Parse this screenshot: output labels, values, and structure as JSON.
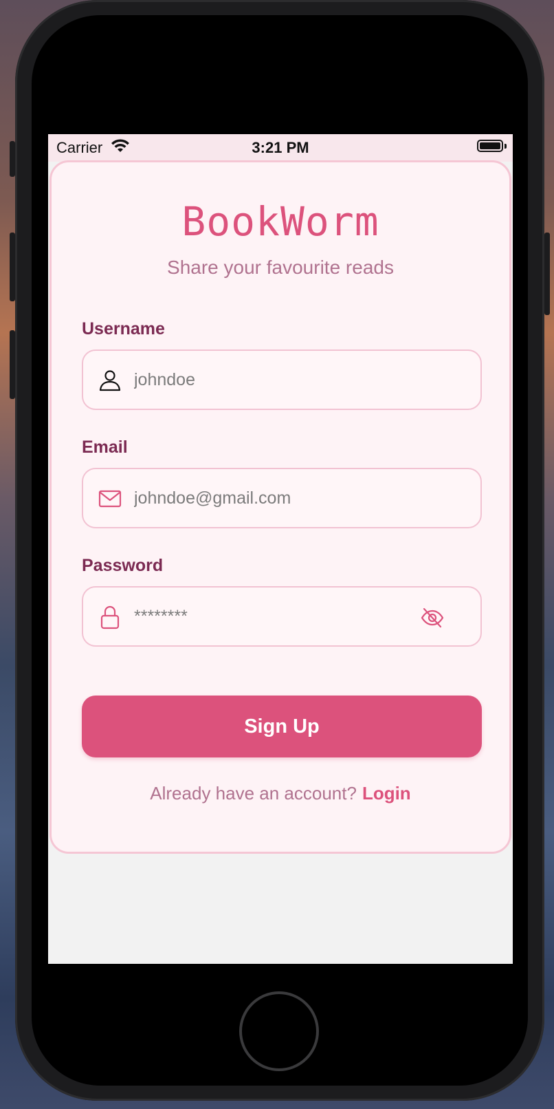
{
  "status_bar": {
    "carrier": "Carrier",
    "time": "3:21 PM",
    "wifi_icon": "wifi-icon",
    "battery_icon": "battery-full-icon"
  },
  "header": {
    "title": "BookWorm",
    "subtitle": "Share your favourite reads"
  },
  "form": {
    "username": {
      "label": "Username",
      "placeholder": "johndoe",
      "icon": "user-icon"
    },
    "email": {
      "label": "Email",
      "placeholder": "johndoe@gmail.com",
      "icon": "mail-icon"
    },
    "password": {
      "label": "Password",
      "placeholder": "********",
      "icon": "lock-icon",
      "toggle_icon": "eye-off-icon"
    },
    "submit_label": "Sign Up"
  },
  "footer": {
    "prompt": "Already have an account?",
    "link_label": "Login"
  },
  "colors": {
    "accent": "#dc527c",
    "label": "#7b2a52",
    "muted": "#b0728f",
    "card_background": "#fef3f6",
    "card_border": "#f5c6d4",
    "status_bar_background": "#f8e7ec"
  }
}
